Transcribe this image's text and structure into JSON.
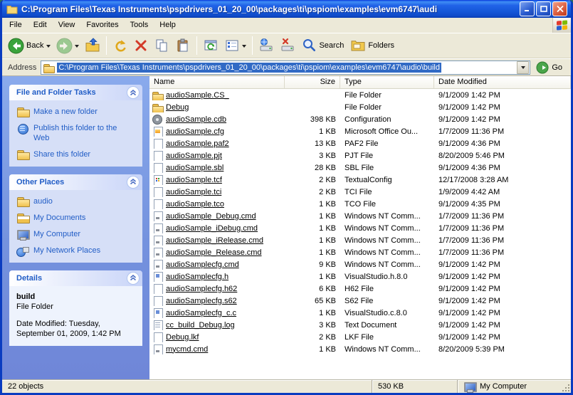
{
  "window": {
    "title": "C:\\Program Files\\Texas Instruments\\pspdrivers_01_20_00\\packages\\ti\\pspiom\\examples\\evm6747\\audi"
  },
  "menu_bar": {
    "items": [
      "File",
      "Edit",
      "View",
      "Favorites",
      "Tools",
      "Help"
    ]
  },
  "toolbar": {
    "back": "Back",
    "search": "Search",
    "folders": "Folders"
  },
  "address_bar": {
    "label": "Address",
    "path": "C:\\Program Files\\Texas Instruments\\pspdrivers_01_20_00\\packages\\ti\\pspiom\\examples\\evm6747\\audio\\build",
    "go": "Go"
  },
  "sidebar": {
    "file_folder_tasks": {
      "title": "File and Folder Tasks",
      "items": [
        {
          "label": "Make a new folder",
          "icon": "new-folder"
        },
        {
          "label": "Publish this folder to the Web",
          "icon": "publish-web"
        },
        {
          "label": "Share this folder",
          "icon": "share-folder"
        }
      ]
    },
    "other_places": {
      "title": "Other Places",
      "items": [
        {
          "label": "audio",
          "icon": "folder"
        },
        {
          "label": "My Documents",
          "icon": "my-documents"
        },
        {
          "label": "My Computer",
          "icon": "my-computer"
        },
        {
          "label": "My Network Places",
          "icon": "network"
        }
      ]
    },
    "details": {
      "title": "Details",
      "name": "build",
      "type": "File Folder",
      "modified_label": "Date Modified: Tuesday, September 01, 2009, 1:42 PM"
    }
  },
  "file_list": {
    "columns": [
      "Name",
      "Size",
      "Type",
      "Date Modified"
    ],
    "rows": [
      {
        "name": "audioSample.CS_",
        "size": "",
        "type": "File Folder",
        "date": "9/1/2009 1:42 PM",
        "icon": "folder"
      },
      {
        "name": "Debug",
        "size": "",
        "type": "File Folder",
        "date": "9/1/2009 1:42 PM",
        "icon": "folder"
      },
      {
        "name": "audioSample.cdb",
        "size": "398 KB",
        "type": "Configuration",
        "date": "9/1/2009 1:42 PM",
        "icon": "gear"
      },
      {
        "name": "audioSample.cfg",
        "size": "1 KB",
        "type": "Microsoft Office Ou...",
        "date": "1/7/2009 11:36 PM",
        "icon": "office"
      },
      {
        "name": "audioSample.paf2",
        "size": "13 KB",
        "type": "PAF2 File",
        "date": "9/1/2009 4:36 PM",
        "icon": "page"
      },
      {
        "name": "audioSample.pjt",
        "size": "3 KB",
        "type": "PJT File",
        "date": "8/20/2009 5:46 PM",
        "icon": "page"
      },
      {
        "name": "audioSample.sbl",
        "size": "28 KB",
        "type": "SBL File",
        "date": "9/1/2009 4:36 PM",
        "icon": "page"
      },
      {
        "name": "audioSample.tcf",
        "size": "2 KB",
        "type": "TextualConfig",
        "date": "12/17/2008 3:28 AM",
        "icon": "dots"
      },
      {
        "name": "audioSample.tci",
        "size": "2 KB",
        "type": "TCI File",
        "date": "1/9/2009 4:42 AM",
        "icon": "page"
      },
      {
        "name": "audioSample.tco",
        "size": "1 KB",
        "type": "TCO File",
        "date": "9/1/2009 4:35 PM",
        "icon": "page"
      },
      {
        "name": "audioSample_Debug.cmd",
        "size": "1 KB",
        "type": "Windows NT Comm...",
        "date": "1/7/2009 11:36 PM",
        "icon": "cmd"
      },
      {
        "name": "audioSample_iDebug.cmd",
        "size": "1 KB",
        "type": "Windows NT Comm...",
        "date": "1/7/2009 11:36 PM",
        "icon": "cmd"
      },
      {
        "name": "audioSample_iRelease.cmd",
        "size": "1 KB",
        "type": "Windows NT Comm...",
        "date": "1/7/2009 11:36 PM",
        "icon": "cmd"
      },
      {
        "name": "audioSample_Release.cmd",
        "size": "1 KB",
        "type": "Windows NT Comm...",
        "date": "1/7/2009 11:36 PM",
        "icon": "cmd"
      },
      {
        "name": "audioSamplecfg.cmd",
        "size": "9 KB",
        "type": "Windows NT Comm...",
        "date": "9/1/2009 1:42 PM",
        "icon": "cmd"
      },
      {
        "name": "audioSamplecfg.h",
        "size": "1 KB",
        "type": "VisualStudio.h.8.0",
        "date": "9/1/2009 1:42 PM",
        "icon": "vs"
      },
      {
        "name": "audioSamplecfg.h62",
        "size": "6 KB",
        "type": "H62 File",
        "date": "9/1/2009 1:42 PM",
        "icon": "page"
      },
      {
        "name": "audioSamplecfg.s62",
        "size": "65 KB",
        "type": "S62 File",
        "date": "9/1/2009 1:42 PM",
        "icon": "page"
      },
      {
        "name": "audioSamplecfg_c.c",
        "size": "1 KB",
        "type": "VisualStudio.c.8.0",
        "date": "9/1/2009 1:42 PM",
        "icon": "vs"
      },
      {
        "name": "cc_build_Debug.log",
        "size": "3 KB",
        "type": "Text Document",
        "date": "9/1/2009 1:42 PM",
        "icon": "text"
      },
      {
        "name": "Debug.lkf",
        "size": "2 KB",
        "type": "LKF File",
        "date": "9/1/2009 1:42 PM",
        "icon": "page"
      },
      {
        "name": "mycmd.cmd",
        "size": "1 KB",
        "type": "Windows NT Comm...",
        "date": "8/20/2009 5:39 PM",
        "icon": "cmd"
      }
    ]
  },
  "status_bar": {
    "objects": "22 objects",
    "size": "530 KB",
    "location": "My Computer"
  }
}
